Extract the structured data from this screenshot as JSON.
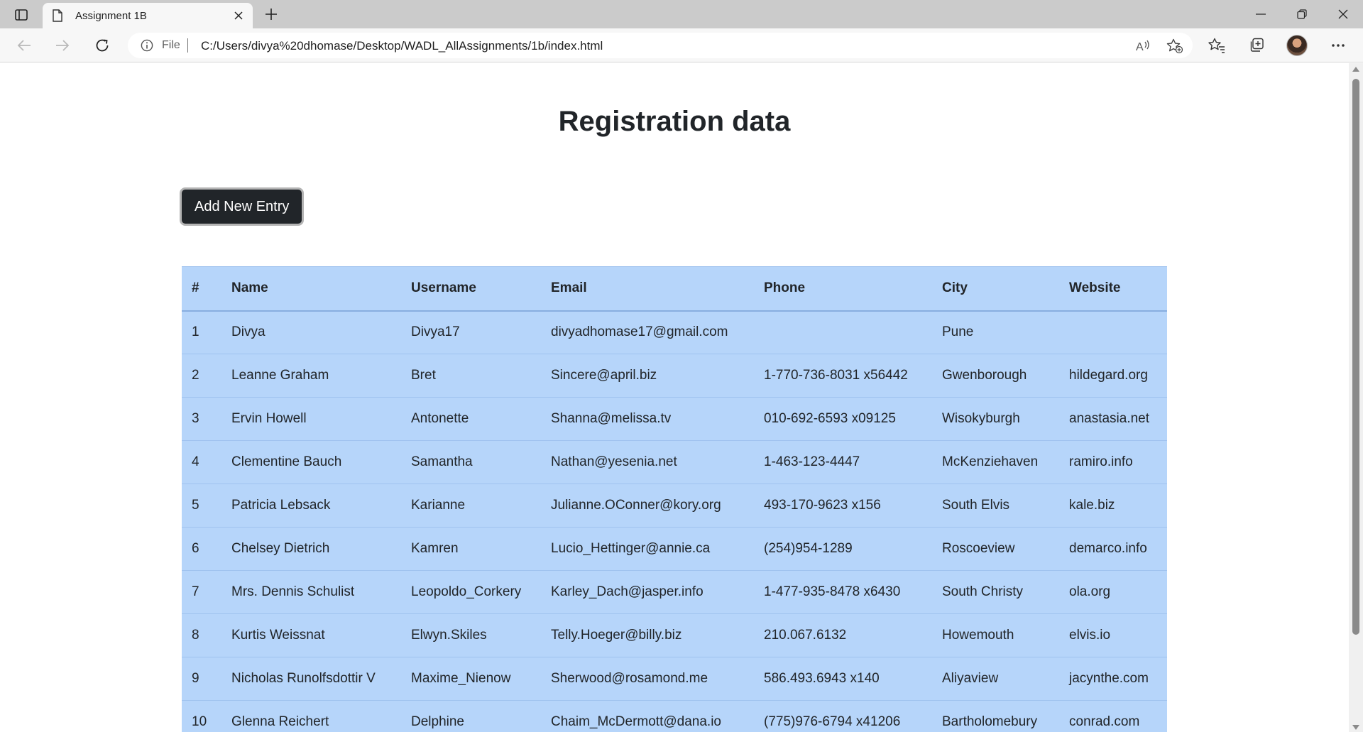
{
  "browser": {
    "tab_title": "Assignment 1B",
    "address_scheme": "File",
    "url": "C:/Users/divya%20dhomase/Desktop/WADL_AllAssignments/1b/index.html"
  },
  "page": {
    "title": "Registration data",
    "add_button_label": "Add New Entry"
  },
  "table": {
    "headers": [
      "#",
      "Name",
      "Username",
      "Email",
      "Phone",
      "City",
      "Website"
    ],
    "rows": [
      [
        "1",
        "Divya",
        "Divya17",
        "divyadhomase17@gmail.com",
        "",
        "Pune",
        ""
      ],
      [
        "2",
        "Leanne Graham",
        "Bret",
        "Sincere@april.biz",
        "1-770-736-8031 x56442",
        "Gwenborough",
        "hildegard.org"
      ],
      [
        "3",
        "Ervin Howell",
        "Antonette",
        "Shanna@melissa.tv",
        "010-692-6593 x09125",
        "Wisokyburgh",
        "anastasia.net"
      ],
      [
        "4",
        "Clementine Bauch",
        "Samantha",
        "Nathan@yesenia.net",
        "1-463-123-4447",
        "McKenziehaven",
        "ramiro.info"
      ],
      [
        "5",
        "Patricia Lebsack",
        "Karianne",
        "Julianne.OConner@kory.org",
        "493-170-9623 x156",
        "South Elvis",
        "kale.biz"
      ],
      [
        "6",
        "Chelsey Dietrich",
        "Kamren",
        "Lucio_Hettinger@annie.ca",
        "(254)954-1289",
        "Roscoeview",
        "demarco.info"
      ],
      [
        "7",
        "Mrs. Dennis Schulist",
        "Leopoldo_Corkery",
        "Karley_Dach@jasper.info",
        "1-477-935-8478 x6430",
        "South Christy",
        "ola.org"
      ],
      [
        "8",
        "Kurtis Weissnat",
        "Elwyn.Skiles",
        "Telly.Hoeger@billy.biz",
        "210.067.6132",
        "Howemouth",
        "elvis.io"
      ],
      [
        "9",
        "Nicholas Runolfsdottir V",
        "Maxime_Nienow",
        "Sherwood@rosamond.me",
        "586.493.6943 x140",
        "Aliyaview",
        "jacynthe.com"
      ],
      [
        "10",
        "Glenna Reichert",
        "Delphine",
        "Chaim_McDermott@dana.io",
        "(775)976-6794 x41206",
        "Bartholomebury",
        "conrad.com"
      ]
    ]
  },
  "colors": {
    "table_bg": "#b6d5fa",
    "button_bg": "#212529"
  }
}
